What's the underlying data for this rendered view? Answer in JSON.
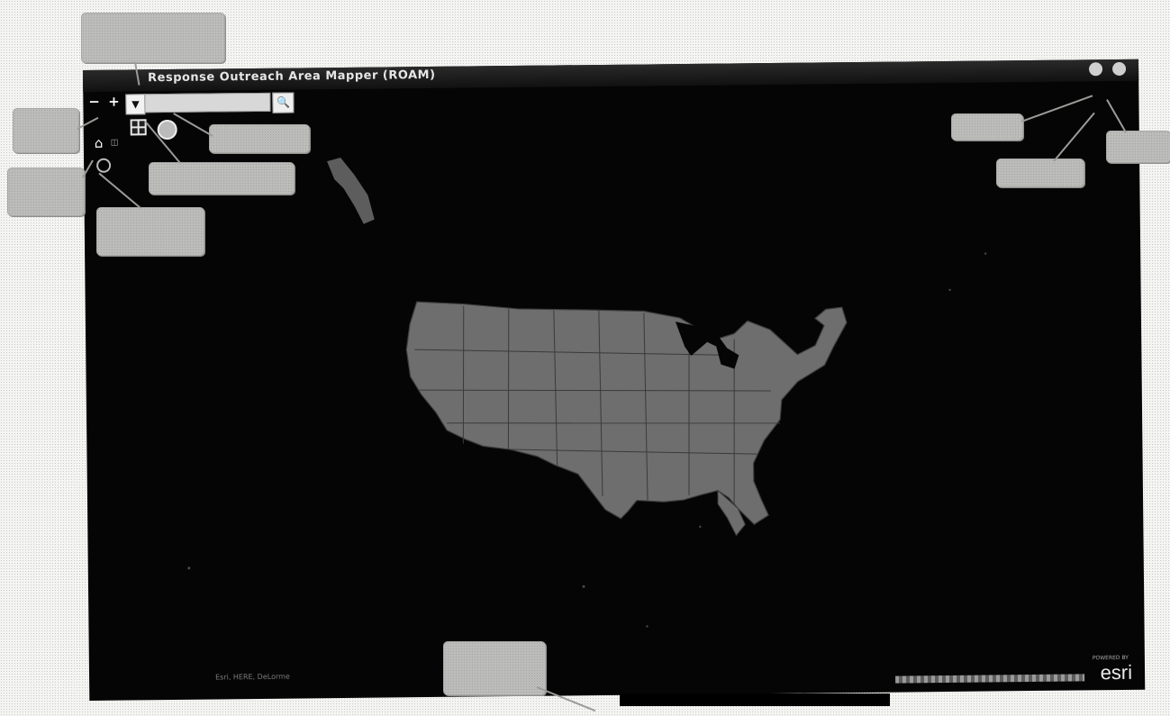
{
  "app": {
    "title": "Response Outreach Area Mapper (ROAM)"
  },
  "toolbar": {
    "zoom_out": "−",
    "zoom_in": "+",
    "search_dropdown": "▼",
    "search_button": "🔍",
    "search_placeholder": ""
  },
  "map": {
    "attribution": "Esri, HERE, DeLorme",
    "logo": "esri",
    "logo_small": "POWERED BY"
  },
  "icons": {
    "home": "home-icon",
    "locate": "locate-icon",
    "legend": "grid-icon",
    "basemap": "basemap-gallery-icon",
    "share": "share-icon",
    "about": "info-icon"
  },
  "colors": {
    "map_background": "#050505",
    "land": "#6e6e6e",
    "callout": "#bcbcba"
  }
}
